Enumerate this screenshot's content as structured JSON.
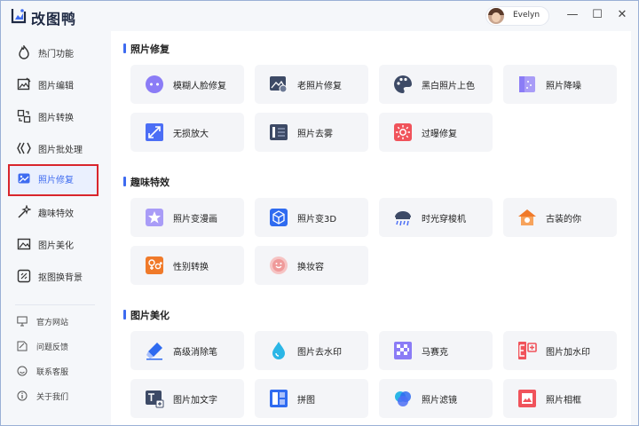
{
  "app": {
    "title": "改图鸭"
  },
  "user": {
    "name": "Evelyn"
  },
  "window_controls": {
    "minimize": "—",
    "maximize": "☐",
    "close": "✕"
  },
  "sidebar": {
    "items": [
      {
        "label": "热门功能",
        "icon": "fire-icon"
      },
      {
        "label": "图片编辑",
        "icon": "image-edit-icon"
      },
      {
        "label": "图片转换",
        "icon": "convert-icon"
      },
      {
        "label": "图片批处理",
        "icon": "batch-icon"
      },
      {
        "label": "照片修复",
        "icon": "photo-repair-icon"
      },
      {
        "label": "趣味特效",
        "icon": "magic-wand-icon"
      },
      {
        "label": "图片美化",
        "icon": "beautify-icon"
      },
      {
        "label": "抠图换背景",
        "icon": "cutout-icon"
      }
    ],
    "bottom_items": [
      {
        "label": "官方网站",
        "icon": "monitor-icon"
      },
      {
        "label": "问题反馈",
        "icon": "feedback-icon"
      },
      {
        "label": "联系客服",
        "icon": "support-icon"
      },
      {
        "label": "关于我们",
        "icon": "info-icon"
      }
    ]
  },
  "sections": [
    {
      "title": "照片修复",
      "cards": [
        {
          "label": "模糊人脸修复",
          "icon": "face-repair-icon"
        },
        {
          "label": "老照片修复",
          "icon": "old-photo-icon"
        },
        {
          "label": "黑白照片上色",
          "icon": "palette-icon"
        },
        {
          "label": "照片降噪",
          "icon": "denoise-icon"
        },
        {
          "label": "无损放大",
          "icon": "enlarge-icon"
        },
        {
          "label": "照片去雾",
          "icon": "defog-icon"
        },
        {
          "label": "过曝修复",
          "icon": "overexposure-icon"
        }
      ]
    },
    {
      "title": "趣味特效",
      "cards": [
        {
          "label": "照片变漫画",
          "icon": "comic-icon"
        },
        {
          "label": "照片变3D",
          "icon": "cube-3d-icon"
        },
        {
          "label": "时光穿梭机",
          "icon": "time-machine-icon"
        },
        {
          "label": "古装的你",
          "icon": "ancient-costume-icon"
        },
        {
          "label": "性别转换",
          "icon": "gender-swap-icon"
        },
        {
          "label": "换妆容",
          "icon": "makeup-icon"
        }
      ]
    },
    {
      "title": "图片美化",
      "cards": [
        {
          "label": "高级消除笔",
          "icon": "eraser-pen-icon"
        },
        {
          "label": "图片去水印",
          "icon": "remove-watermark-icon"
        },
        {
          "label": "马赛克",
          "icon": "mosaic-icon"
        },
        {
          "label": "图片加水印",
          "icon": "add-watermark-icon"
        },
        {
          "label": "图片加文字",
          "icon": "add-text-icon"
        },
        {
          "label": "拼图",
          "icon": "collage-icon"
        },
        {
          "label": "照片滤镜",
          "icon": "filter-icon"
        },
        {
          "label": "照片相框",
          "icon": "frame-icon"
        }
      ]
    }
  ],
  "colors": {
    "accent": "#3e6bf0",
    "highlight_border": "#d9262c",
    "card_bg": "#f4f5f8",
    "background": "#f5f7fa"
  }
}
